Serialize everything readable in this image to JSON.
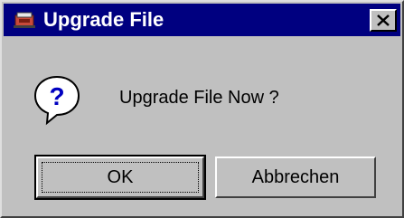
{
  "window": {
    "title": "Upgrade File",
    "title_icon": "upgrade-app-icon",
    "close_icon": "close-icon"
  },
  "message": {
    "icon": "question-icon",
    "text": "Upgrade File Now ?"
  },
  "buttons": {
    "ok_label": "OK",
    "cancel_label": "Abbrechen"
  },
  "colors": {
    "titlebar": "#000080",
    "face": "#c0c0c0",
    "title_text": "#ffffff"
  }
}
